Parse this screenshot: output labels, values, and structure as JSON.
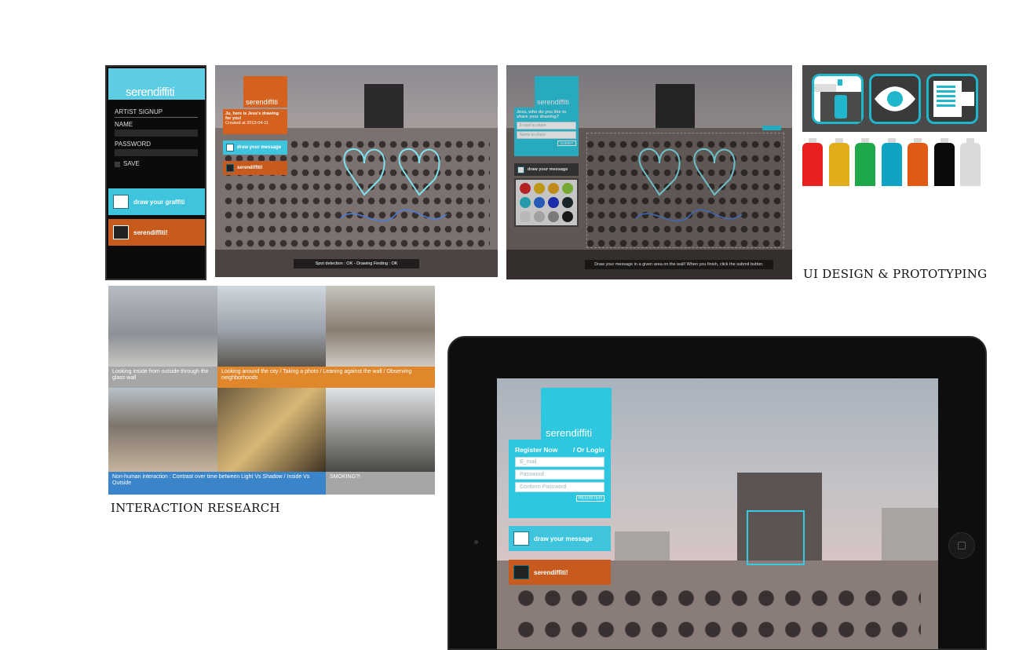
{
  "colors": {
    "cyan": "#2ec7e0",
    "orange": "#c75b1e",
    "panel": "#4a4a4a"
  },
  "panel1": {
    "logo": "serendiffiti",
    "title": "ARTIST SIGNUP",
    "name_label": "NAME",
    "password_label": "PASSWORD",
    "save_label": "SAVE",
    "draw_button": "draw your graffiti",
    "view_button": "serendiffiti!"
  },
  "panel2": {
    "logo": "serendiffiti",
    "message": "Ju, here is Jess's drawing for you!",
    "created": "Created at 2013-04-11",
    "draw_button": "draw your message",
    "view_button": "serendiffiti!",
    "status": "Spot detection : OK - Drawing Finding : OK"
  },
  "panel3": {
    "logo": "serendiffiti",
    "question": "Jess, who do you like to share your drawing?",
    "email_placeholder": "E-mail to share",
    "name_placeholder": "Name to share",
    "submit": "SUBMIT",
    "draw_button": "draw your message",
    "instruction": "Draw your message in a given area on the wall! When you finish, click the submit button.",
    "palette": [
      "#d42a2a",
      "#e2b11a",
      "#e1a21d",
      "#8bc73c",
      "#29b6c8",
      "#2b6bd6",
      "#2234c6",
      "#1e2c33",
      "#d9d9d9",
      "#bdbdbd",
      "#8f8f8f",
      "#1c1c1c"
    ]
  },
  "icons_panel": {
    "icons": [
      "spray-can-icon",
      "eye-icon",
      "brush-icon"
    ],
    "can_colors": [
      "#e8201f",
      "#e2ad1a",
      "#1ea84a",
      "#10a4c4",
      "#e15a13",
      "#0a0a0a",
      "#dadada"
    ]
  },
  "headings": {
    "ui": "UI DESIGN & PROTOTYPING",
    "research": "INTERACTION RESEARCH"
  },
  "research": {
    "caption1": "Looking inside from outside through the glass wall",
    "caption2": "Looking around the city / Taking a photo / Leaning against the wall / Observing neighborhoods",
    "caption3": "Non-human interaction : Contrast over time between Light Vs Shadow / Inside Vs Outside",
    "caption4": "SMOKING?!"
  },
  "tablet": {
    "logo": "serendiffiti",
    "register_now": "Register Now",
    "or_login": "/ Or Login",
    "email_placeholder": "E_mail",
    "password_placeholder": "Password",
    "confirm_placeholder": "Conform Password",
    "register": "REGISTER",
    "draw_button": "draw your message",
    "view_button": "serendiffiti!"
  }
}
